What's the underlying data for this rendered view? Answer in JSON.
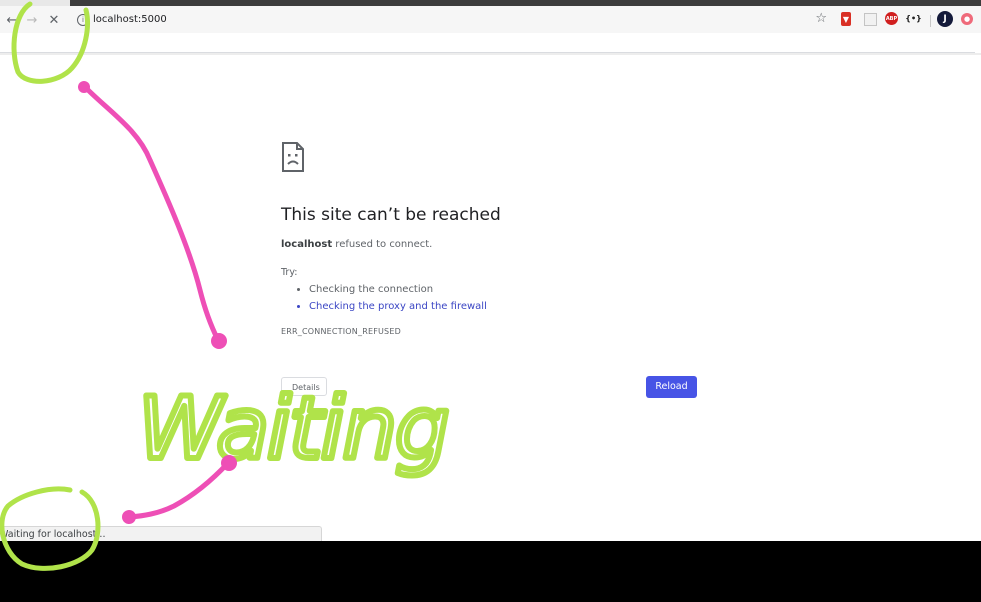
{
  "browser": {
    "url": "localhost:5000",
    "nav": {
      "back_icon": "arrow-left-icon",
      "forward_icon": "arrow-right-icon",
      "stop_icon": "close-icon"
    },
    "extensions": {
      "json_label": "{•}",
      "avatar_initial": "J"
    },
    "status": "Waiting for localhost..."
  },
  "error": {
    "title": "This site can’t be reached",
    "host": "localhost",
    "desc_rest": " refused to connect.",
    "try_label": "Try:",
    "suggestions": [
      "Checking the connection",
      "Checking the proxy and the firewall"
    ],
    "code": "ERR_CONNECTION_REFUSED",
    "details_label": "Details",
    "reload_label": "Reload"
  },
  "annotation": {
    "text": "Waiting",
    "green": "#b0e34a",
    "pink": "#ee4fb6"
  },
  "colors": {
    "accent": "#4754e6",
    "link": "#3b46c4"
  }
}
